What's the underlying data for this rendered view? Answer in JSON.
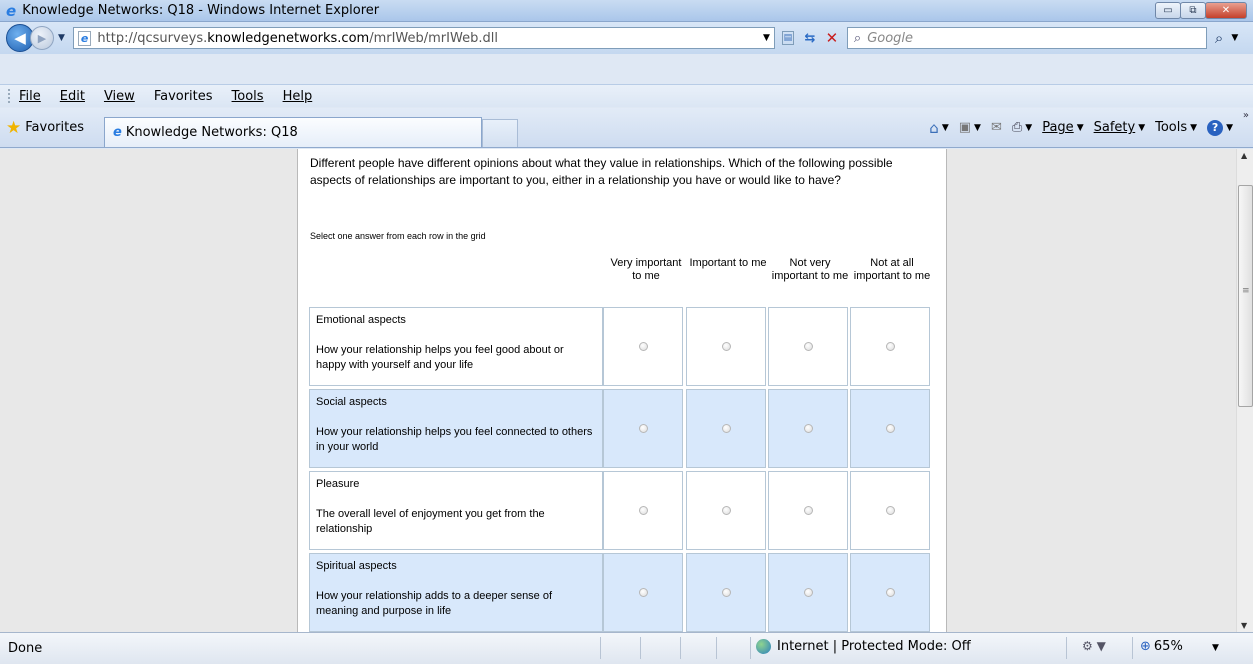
{
  "window": {
    "title": "Knowledge Networks: Q18 - Windows Internet Explorer",
    "buttons": {
      "minimize": "▭",
      "maximize": "⧉",
      "close": "✕"
    }
  },
  "address": {
    "url_prefix": "http://qcsurveys.",
    "url_domain": "knowledgenetworks.com",
    "url_path": "/mrIWeb/mrIWeb.dll",
    "search_placeholder": "Google"
  },
  "menu": {
    "items": [
      "File",
      "Edit",
      "View",
      "Favorites",
      "Tools",
      "Help"
    ]
  },
  "favbar": {
    "favorites_label": "Favorites",
    "tab_title": "Knowledge Networks: Q18",
    "commands": {
      "page": "Page",
      "safety": "Safety",
      "tools": "Tools"
    }
  },
  "survey": {
    "question": "Different people have different opinions about what they value in relationships. Which of the following possible aspects of relationships are important to you, either in a relationship you have or would like to have?",
    "instruction": "Select one answer from each row in the grid",
    "columns": [
      "Very important to me",
      "Important to me",
      "Not very important to me",
      "Not at all important to me"
    ],
    "rows": [
      {
        "aspect": "Emotional aspects",
        "desc": "How your relationship helps you feel good about or happy with yourself and your life"
      },
      {
        "aspect": "Social aspects",
        "desc": "How your relationship helps you feel connected to others in your world"
      },
      {
        "aspect": "Pleasure",
        "desc": "The overall level of enjoyment you get from the relationship"
      },
      {
        "aspect": "Spiritual aspects",
        "desc": "How your relationship adds to a deeper sense of meaning and purpose in life"
      }
    ]
  },
  "status": {
    "text": "Done",
    "zone": "Internet | Protected Mode: Off",
    "zoom": "65%"
  },
  "colors": {
    "row_alt": "#d8e8fb",
    "border": "#b6c7d6"
  }
}
